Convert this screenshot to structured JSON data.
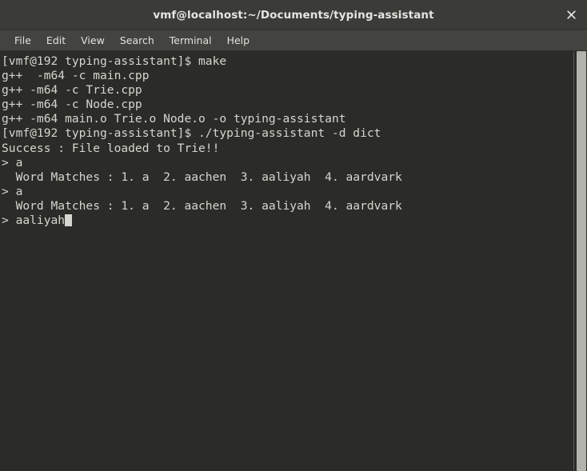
{
  "window": {
    "title": "vmf@localhost:~/Documents/typing-assistant",
    "close_icon": "close-icon"
  },
  "menubar": {
    "items": [
      {
        "label": "File"
      },
      {
        "label": "Edit"
      },
      {
        "label": "View"
      },
      {
        "label": "Search"
      },
      {
        "label": "Terminal"
      },
      {
        "label": "Help"
      }
    ]
  },
  "terminal": {
    "lines": [
      "[vmf@192 typing-assistant]$ make",
      "g++  -m64 -c main.cpp",
      "g++ -m64 -c Trie.cpp",
      "g++ -m64 -c Node.cpp",
      "g++ -m64 main.o Trie.o Node.o -o typing-assistant",
      "[vmf@192 typing-assistant]$ ./typing-assistant -d dict",
      "Success : File loaded to Trie!!",
      "> a",
      "  Word Matches : 1. a  2. aachen  3. aaliyah  4. aardvark",
      "> a",
      "  Word Matches : 1. a  2. aachen  3. aaliyah  4. aardvark"
    ],
    "current_prompt": "> aaliyah",
    "cursor": "block-cursor"
  },
  "colors": {
    "titlebar_bg": "#3b3b38",
    "menubar_bg": "#43433f",
    "terminal_bg": "#2b2b28",
    "terminal_fg": "#d6d6d0",
    "scrollbar_thumb": "#b3b3ad"
  }
}
